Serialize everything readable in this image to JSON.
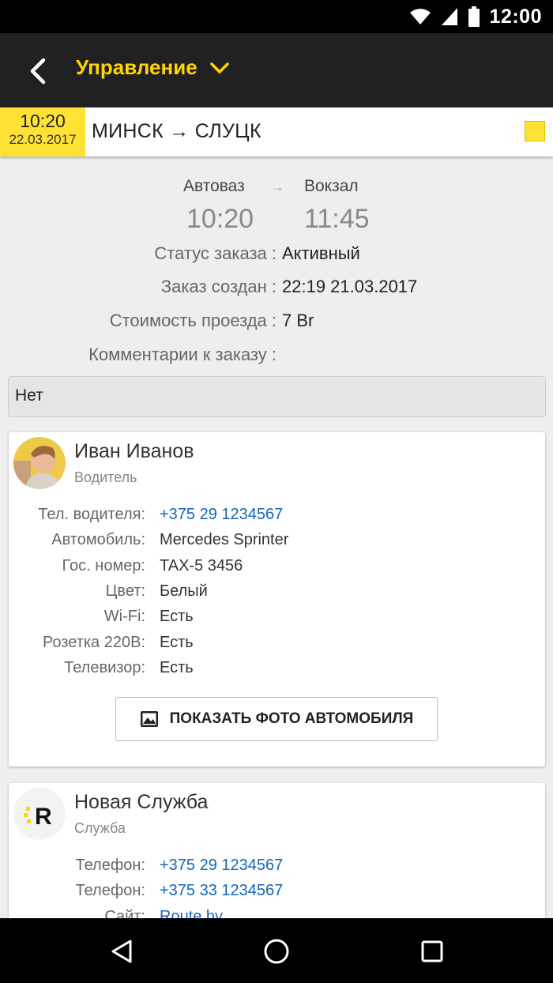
{
  "status_bar": {
    "time": "12:00",
    "icons": [
      "wifi-icon",
      "signal-icon",
      "battery-icon"
    ]
  },
  "app_bar": {
    "title": "Управление",
    "back_icon": "back-arrow-icon",
    "dropdown_icon": "chevron-down-icon"
  },
  "trip": {
    "time": "10:20",
    "date": "22.03.2017",
    "route": "МИНСК → СЛУЦК",
    "accent_color": "#ffe233"
  },
  "stops": {
    "from_name": "Автоваз",
    "to_name": "Вокзал",
    "arrow": "→",
    "from_time": "10:20",
    "to_time": "11:45"
  },
  "order_info": [
    {
      "label": "Статус заказа :",
      "value": "Активный"
    },
    {
      "label": "Заказ создан :",
      "value": "22:19 21.03.2017"
    },
    {
      "label": "Стоимость проезда :",
      "value": "7 Br"
    },
    {
      "label": "Комментарии к заказу :",
      "value": ""
    }
  ],
  "comment": "Нет",
  "driver": {
    "name": "Иван Иванов",
    "role": "Водитель",
    "fields": [
      {
        "label": "Тел. водителя:",
        "value": "+375 29 1234567",
        "link": true
      },
      {
        "label": "Автомобиль:",
        "value": "Mercedes Sprinter"
      },
      {
        "label": "Гос. номер:",
        "value": "TAX-5 3456"
      },
      {
        "label": "Цвет:",
        "value": "Белый"
      },
      {
        "label": "Wi-Fi:",
        "value": "Есть"
      },
      {
        "label": "Розетка 220В:",
        "value": "Есть"
      },
      {
        "label": "Телевизор:",
        "value": "Есть"
      }
    ],
    "photo_button": "ПОКАЗАТЬ ФОТО АВТОМОБИЛЯ"
  },
  "service": {
    "name": "Новая Служба",
    "role": "Служба",
    "logo_letter": "R",
    "fields": [
      {
        "label": "Телефон:",
        "value": "+375 29 1234567",
        "link": true
      },
      {
        "label": "Телефон:",
        "value": "+375 33 1234567",
        "link": true
      },
      {
        "label": "Сайт:",
        "value": "Route.by",
        "link": true
      }
    ]
  },
  "colors": {
    "accent": "#ffd600",
    "link": "#1565c0",
    "appbar": "#212121"
  }
}
